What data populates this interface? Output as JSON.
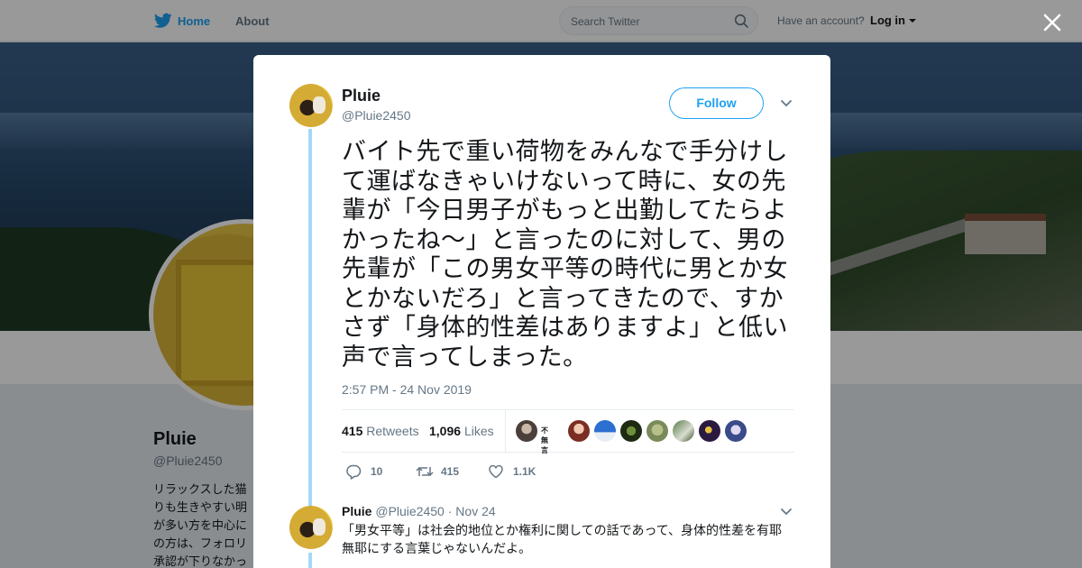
{
  "topbar": {
    "home_label": "Home",
    "about_label": "About",
    "search_placeholder": "Search Twitter",
    "account_prompt": "Have an account?",
    "login_label": "Log in"
  },
  "profile": {
    "name": "Pluie",
    "handle": "@Pluie2450",
    "bio_lines": [
      "リラックスした猫",
      "りも生きやすい明",
      "が多い方を中心に",
      "の方は、フォロリ",
      "承認が下りなかっ"
    ]
  },
  "tweet": {
    "author_name": "Pluie",
    "author_handle": "@Pluie2450",
    "follow_label": "Follow",
    "text": "バイト先で重い荷物をみんなで手分けして運ばなきゃいけないって時に、女の先輩が「今日男子がもっと出勤してたらよかったね〜」と言ったのに対して、男の先輩が「この男女平等の時代に男とか女とかないだろ」と言ってきたので、すかさず「身体的性差はありますよ」と低い声で言ってしまった。",
    "timestamp": "2:57 PM - 24 Nov 2019",
    "retweets_count": "415",
    "retweets_label": "Retweets",
    "likes_count": "1,096",
    "likes_label": "Likes",
    "liker_badge_text": "不無言",
    "actions": {
      "reply_count": "10",
      "retweet_count": "415",
      "like_count": "1.1K"
    }
  },
  "reply": {
    "name": "Pluie",
    "handle": "@Pluie2450",
    "date": "· Nov 24",
    "text": "「男女平等」は社会的地位とか権利に関しての話であって、身体的性差を有耶無耶にする言葉じゃないんだよ。"
  },
  "colors": {
    "accent": "#1da1f2",
    "thread_line": "#a5d8f7",
    "muted_text": "#657786",
    "overlay": "rgba(0,0,0,0.40)"
  },
  "icons": [
    "twitter-bird-icon",
    "search-icon",
    "close-icon",
    "chevron-down-icon",
    "reply-icon",
    "retweet-icon",
    "heart-icon"
  ]
}
